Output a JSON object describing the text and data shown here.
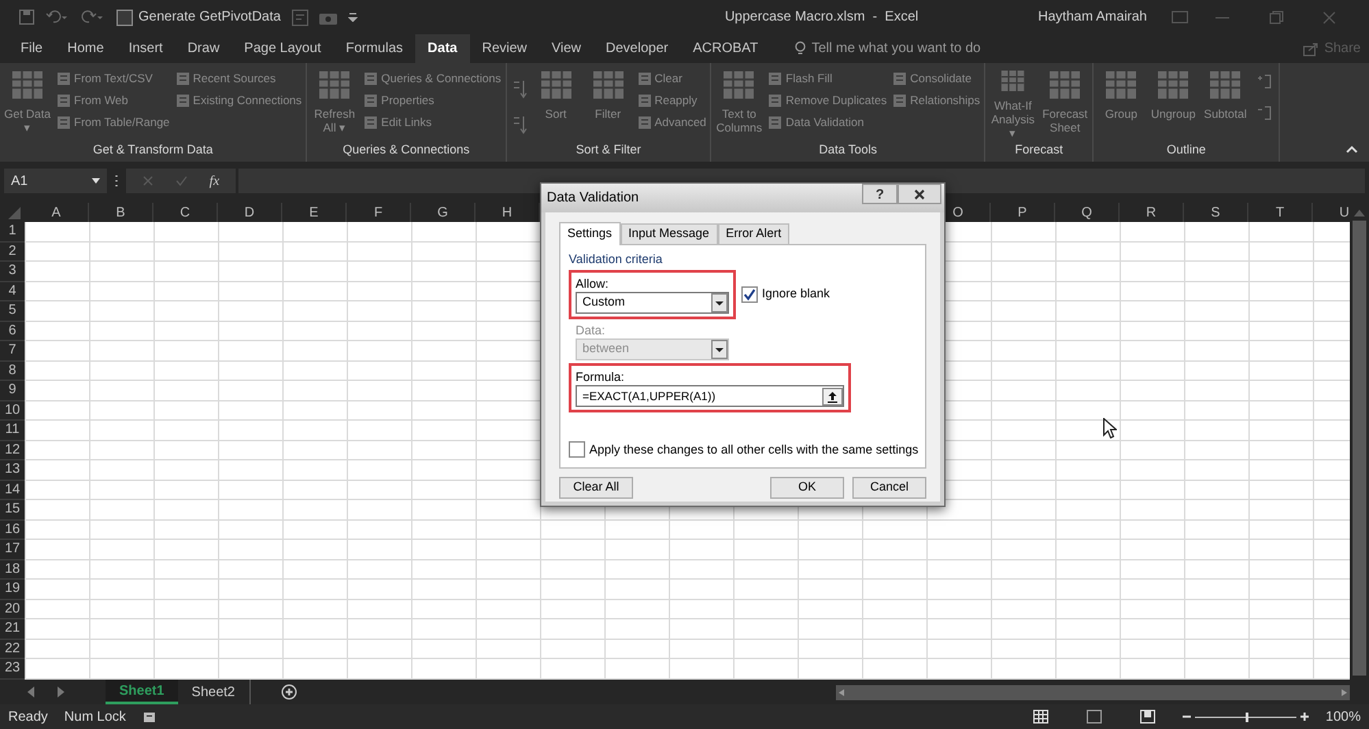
{
  "title_bar": {
    "pivot_checkbox": {
      "label": "Generate GetPivotData",
      "checked": false
    },
    "title": "Uppercase Macro.xlsm  -  Excel",
    "user": "Haytham Amairah"
  },
  "tabs": [
    {
      "label": "File",
      "selected": false
    },
    {
      "label": "Home",
      "selected": false
    },
    {
      "label": "Insert",
      "selected": false
    },
    {
      "label": "Draw",
      "selected": false
    },
    {
      "label": "Page Layout",
      "selected": false
    },
    {
      "label": "Formulas",
      "selected": false
    },
    {
      "label": "Data",
      "selected": true
    },
    {
      "label": "Review",
      "selected": false
    },
    {
      "label": "View",
      "selected": false
    },
    {
      "label": "Developer",
      "selected": false
    },
    {
      "label": "ACROBAT",
      "selected": false
    }
  ],
  "tell_me": {
    "placeholder": "Tell me what you want to do"
  },
  "share": "Share",
  "ribbon": {
    "groups": [
      {
        "label": "Get & Transform Data",
        "columns": [
          {
            "kind": "large",
            "label": "Get Data ▾"
          },
          {
            "kind": "stack",
            "items": [
              "From Text/CSV",
              "From Web",
              "From Table/Range"
            ]
          },
          {
            "kind": "stack",
            "items": [
              "Recent Sources",
              "Existing Connections"
            ]
          }
        ]
      },
      {
        "label": "Queries & Connections",
        "columns": [
          {
            "kind": "large",
            "label": "Refresh All ▾"
          },
          {
            "kind": "stack",
            "items": [
              "Queries & Connections",
              "Properties",
              "Edit Links"
            ]
          }
        ]
      },
      {
        "label": "Sort & Filter",
        "columns": [
          {
            "kind": "sorticons"
          },
          {
            "kind": "large",
            "label": "Sort"
          },
          {
            "kind": "large",
            "label": "Filter"
          },
          {
            "kind": "stack",
            "items": [
              "Clear",
              "Reapply",
              "Advanced"
            ]
          }
        ]
      },
      {
        "label": "Data Tools",
        "columns": [
          {
            "kind": "large",
            "label": "Text to Columns"
          },
          {
            "kind": "stack",
            "items": [
              "Flash Fill",
              "Remove Duplicates",
              "Data Validation"
            ]
          },
          {
            "kind": "stack",
            "items": [
              "Consolidate",
              "Relationships"
            ]
          }
        ]
      },
      {
        "label": "Forecast",
        "columns": [
          {
            "kind": "large",
            "label": "What-If Analysis ▾"
          },
          {
            "kind": "large",
            "label": "Forecast Sheet"
          }
        ]
      },
      {
        "label": "Outline",
        "columns": [
          {
            "kind": "large",
            "label": "Group"
          },
          {
            "kind": "large",
            "label": "Ungroup"
          },
          {
            "kind": "large",
            "label": "Subtotal"
          },
          {
            "kind": "sideicons"
          }
        ]
      }
    ]
  },
  "formula_bar": {
    "name_box": "A1",
    "function_label": "fx"
  },
  "sheet": {
    "columns_left": [
      "A",
      "B",
      "C",
      "D",
      "E",
      "F",
      "G",
      "H"
    ],
    "columns_right": [
      "O",
      "P",
      "Q",
      "R",
      "S",
      "T",
      "U"
    ],
    "rows": [
      "1",
      "2",
      "3",
      "4",
      "5",
      "6",
      "7",
      "8",
      "9",
      "10",
      "11",
      "12",
      "13",
      "14",
      "15",
      "16",
      "17",
      "18",
      "19",
      "20",
      "21",
      "22",
      "23"
    ]
  },
  "dialog": {
    "title": "Data Validation",
    "help": "?",
    "tabs": [
      {
        "label": "Settings",
        "selected": true
      },
      {
        "label": "Input Message",
        "selected": false
      },
      {
        "label": "Error Alert",
        "selected": false
      }
    ],
    "section": "Validation criteria",
    "allow": {
      "label": "Allow:",
      "value": "Custom",
      "highlighted": true,
      "disabled": false
    },
    "ignore_blank": {
      "label": "Ignore blank",
      "checked": true
    },
    "data": {
      "label": "Data:",
      "value": "between",
      "highlighted": false,
      "disabled": true
    },
    "formula": {
      "label": "Formula:",
      "value": "=EXACT(A1,UPPER(A1))",
      "highlighted": true
    },
    "apply_all": {
      "label": "Apply these changes to all other cells with the same settings",
      "checked": false
    },
    "buttons": [
      {
        "label": "Clear All",
        "kind": "left"
      },
      {
        "label": "OK",
        "kind": "default"
      },
      {
        "label": "Cancel",
        "kind": "normal"
      }
    ]
  },
  "sheet_tabs": [
    {
      "label": "Sheet1",
      "selected": true
    },
    {
      "label": "Sheet2",
      "selected": false
    }
  ],
  "status_bar": {
    "items": [
      "Ready",
      "Num Lock"
    ],
    "zoom": "100%",
    "zoom_level": {
      "level": 0.5
    }
  }
}
